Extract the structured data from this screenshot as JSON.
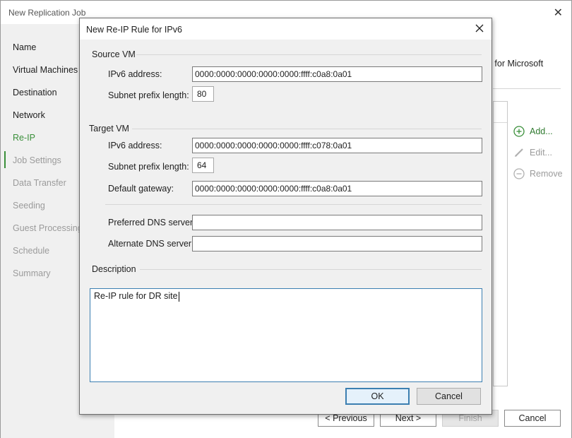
{
  "wizard": {
    "title": "New Replication Job",
    "close_glyph": "✕",
    "steps": [
      {
        "label": "Name",
        "state": "enabled"
      },
      {
        "label": "Virtual Machines",
        "state": "enabled"
      },
      {
        "label": "Destination",
        "state": "enabled"
      },
      {
        "label": "Network",
        "state": "enabled"
      },
      {
        "label": "Re-IP",
        "state": "active"
      },
      {
        "label": "Job Settings",
        "state": "disabled"
      },
      {
        "label": "Data Transfer",
        "state": "disabled"
      },
      {
        "label": "Seeding",
        "state": "disabled"
      },
      {
        "label": "Guest Processing",
        "state": "disabled"
      },
      {
        "label": "Schedule",
        "state": "disabled"
      },
      {
        "label": "Summary",
        "state": "disabled"
      }
    ],
    "description_fragment": "d for Microsoft",
    "actions": {
      "add": "Add...",
      "edit": "Edit...",
      "remove": "Remove"
    },
    "buttons": {
      "previous": "< Previous",
      "next": "Next >",
      "finish": "Finish",
      "cancel": "Cancel"
    }
  },
  "dialog": {
    "title": "New Re-IP Rule for IPv6",
    "source": {
      "group_label": "Source VM",
      "ipv6_label": "IPv6 address:",
      "ipv6_value": "0000:0000:0000:0000:0000:ffff:c0a8:0a01",
      "prefix_label": "Subnet prefix length:",
      "prefix_value": "80"
    },
    "target": {
      "group_label": "Target VM",
      "ipv6_label": "IPv6 address:",
      "ipv6_value": "0000:0000:0000:0000:0000:ffff:c078:0a01",
      "prefix_label": "Subnet prefix length:",
      "prefix_value": "64",
      "gateway_label": "Default gateway:",
      "gateway_value": "0000:0000:0000:0000:0000:ffff:c0a8:0a01",
      "preferred_dns_label": "Preferred DNS server:",
      "preferred_dns_value": "",
      "alternate_dns_label": "Alternate DNS server:",
      "alternate_dns_value": ""
    },
    "description": {
      "group_label": "Description",
      "value": "Re-IP rule for DR site"
    },
    "buttons": {
      "ok": "OK",
      "cancel": "Cancel"
    }
  },
  "colors": {
    "accent_green": "#3a8f3a",
    "focus_blue": "#3c7fb1"
  }
}
